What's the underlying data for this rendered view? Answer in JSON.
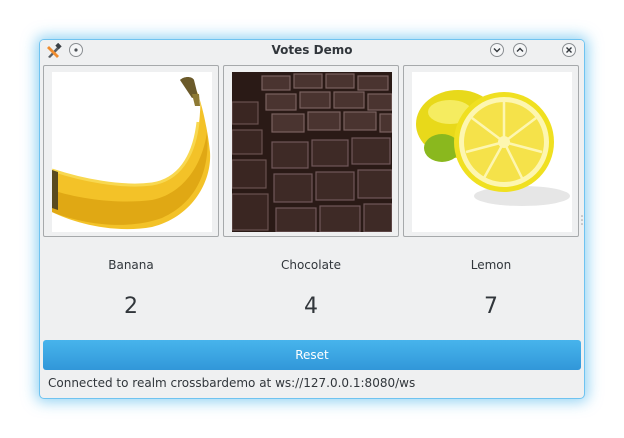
{
  "window": {
    "title": "Votes Demo",
    "accent_color": "#3daee9",
    "buttons": [
      "menu-icon",
      "keep-on-top-icon",
      "minimize-icon",
      "maximize-icon",
      "close-icon"
    ]
  },
  "options": [
    {
      "label": "Banana",
      "votes": "2",
      "image": "banana-image"
    },
    {
      "label": "Chocolate",
      "votes": "4",
      "image": "chocolate-image"
    },
    {
      "label": "Lemon",
      "votes": "7",
      "image": "lemon-image"
    }
  ],
  "reset": {
    "label": "Reset"
  },
  "status": {
    "text": "Connected to realm crossbardemo at ws://127.0.0.1:8080/ws"
  }
}
